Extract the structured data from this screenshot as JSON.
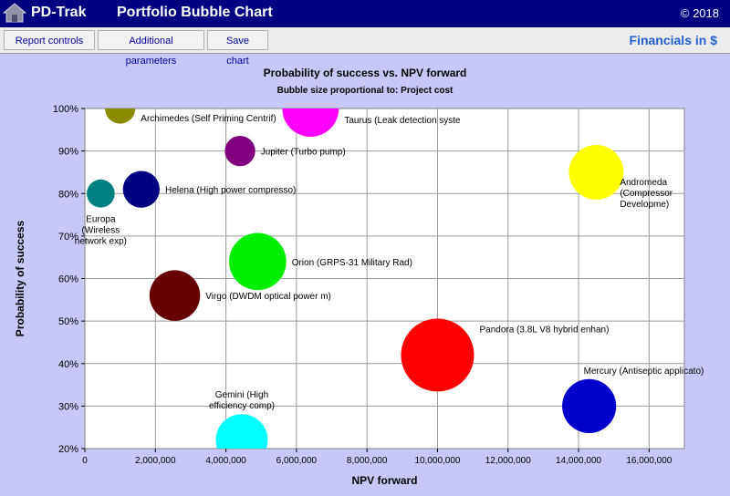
{
  "header": {
    "app_name": "PD-Trak",
    "title": "Portfolio Bubble Chart",
    "copyright": "© 2018"
  },
  "toolbar": {
    "report_controls": "Report controls",
    "additional_parameters": "Additional parameters",
    "save_chart": "Save chart",
    "financials": "Financials in $"
  },
  "colors": {
    "titlebar": "#000080",
    "background": "#c8c8f8"
  },
  "chart_data": {
    "type": "scatter",
    "title": "Probability of success vs. NPV forward",
    "subtitle": "Bubble size proportional to:  Project cost",
    "xlabel": "NPV forward",
    "ylabel": "Probability of success",
    "xlim": [
      0,
      17000000
    ],
    "ylim": [
      0.2,
      1.0
    ],
    "x_ticks": [
      0,
      2000000,
      4000000,
      6000000,
      8000000,
      10000000,
      12000000,
      14000000,
      16000000
    ],
    "x_tick_labels": [
      "0",
      "2,000,000",
      "4,000,000",
      "6,000,000",
      "8,000,000",
      "10,000,000",
      "12,000,000",
      "14,000,000",
      "16,000,000"
    ],
    "y_ticks": [
      0.2,
      0.3,
      0.4,
      0.5,
      0.6,
      0.7,
      0.8,
      0.9,
      1.0
    ],
    "y_tick_labels": [
      "20%",
      "30%",
      "40%",
      "50%",
      "60%",
      "70%",
      "80%",
      "90%",
      "100%"
    ],
    "grid": true,
    "points": [
      {
        "label": "Archimedes (Self Priming Centrif)",
        "x": 1000000,
        "y": 1.0,
        "size": 1.3,
        "color": "#8b8b00",
        "anchor": "right"
      },
      {
        "label": "Taurus (Leak detection syste",
        "x": 6400000,
        "y": 1.0,
        "size": 4.5,
        "color": "#ff00ff",
        "anchor": "right"
      },
      {
        "label": "Jupiter (Turbo pump)",
        "x": 4400000,
        "y": 0.9,
        "size": 1.3,
        "color": "#800080",
        "anchor": "right"
      },
      {
        "label": "Helena (High power compresso)",
        "x": 1600000,
        "y": 0.81,
        "size": 1.9,
        "color": "#000080",
        "anchor": "right"
      },
      {
        "label": "Europa (Wireless network exp)",
        "label_lines": [
          "Europa",
          "(Wireless",
          "network exp)"
        ],
        "x": 450000,
        "y": 0.8,
        "size": 1.1,
        "color": "#008080",
        "anchor": "below"
      },
      {
        "label": "Andromeda (Compressor Developme)",
        "label_lines": [
          "Andromeda",
          "(Compressor",
          "Developme)"
        ],
        "x": 14500000,
        "y": 0.85,
        "size": 4.2,
        "color": "#ffff00",
        "anchor": "right"
      },
      {
        "label": "Orion (GRPS-31 Military Rad)",
        "x": 4900000,
        "y": 0.64,
        "size": 4.6,
        "color": "#00ee00",
        "anchor": "right"
      },
      {
        "label": "Virgo (DWDM optical power m)",
        "x": 2550000,
        "y": 0.56,
        "size": 3.6,
        "color": "#660000",
        "anchor": "right"
      },
      {
        "label": "Pandora (3.8L V8 hybrid enhan)",
        "x": 10000000,
        "y": 0.42,
        "size": 7.5,
        "color": "#ff0000",
        "anchor": "right-up"
      },
      {
        "label": "Mercury (Antiseptic applicato)",
        "x": 14300000,
        "y": 0.3,
        "size": 4.1,
        "color": "#0000cc",
        "anchor": "above"
      },
      {
        "label": "Gemini (High efficiency comp)",
        "label_lines": [
          "Gemini (High",
          "efficiency comp)"
        ],
        "x": 4450000,
        "y": 0.22,
        "size": 3.8,
        "color": "#00ffff",
        "anchor": "above"
      }
    ]
  }
}
